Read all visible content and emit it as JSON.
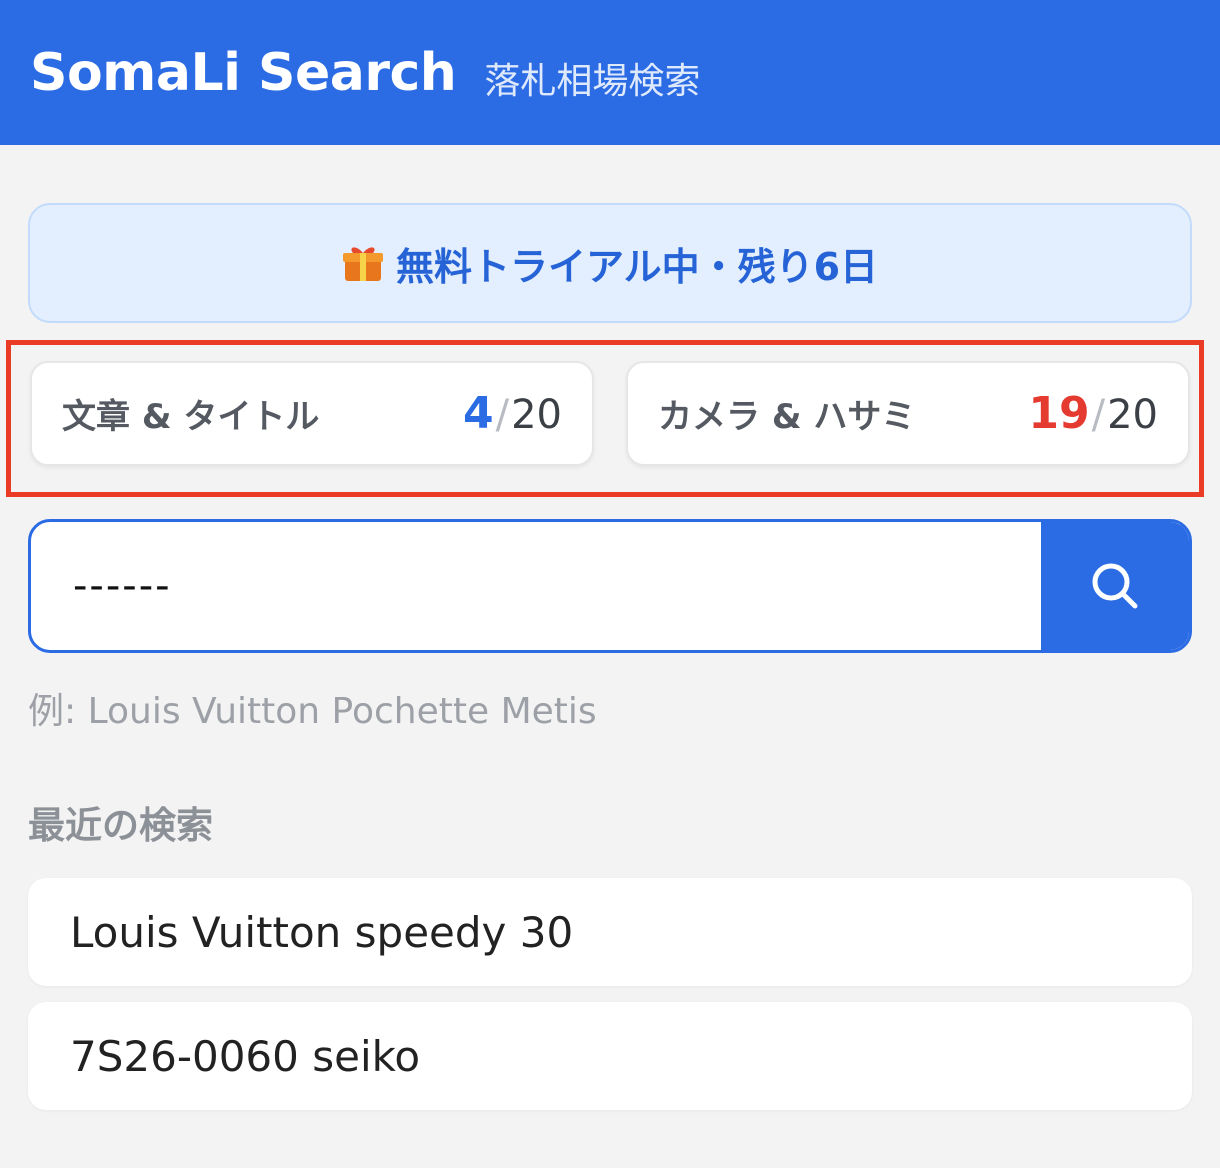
{
  "header": {
    "brand": "SomaLi Search",
    "subtitle": "落札相場検索"
  },
  "trial_banner": {
    "icon": "gift-icon",
    "text": "無料トライアル中・残り6日"
  },
  "quotas": [
    {
      "label": "文章 & タイトル",
      "used": "4",
      "separator": "/",
      "total": "20",
      "color": "#2b6be4"
    },
    {
      "label": "カメラ & ハサミ",
      "used": "19",
      "separator": "/",
      "total": "20",
      "color": "#e53a2f"
    }
  ],
  "search": {
    "value": "------",
    "icon": "search-icon",
    "hint": "例: Louis Vuitton Pochette Metis"
  },
  "recent": {
    "title": "最近の検索",
    "items": [
      "Louis Vuitton speedy 30",
      "7S26-0060 seiko"
    ]
  },
  "colors": {
    "primary": "#2b6be4",
    "highlight": "#ea3b26",
    "banner_bg": "#e3effe"
  }
}
